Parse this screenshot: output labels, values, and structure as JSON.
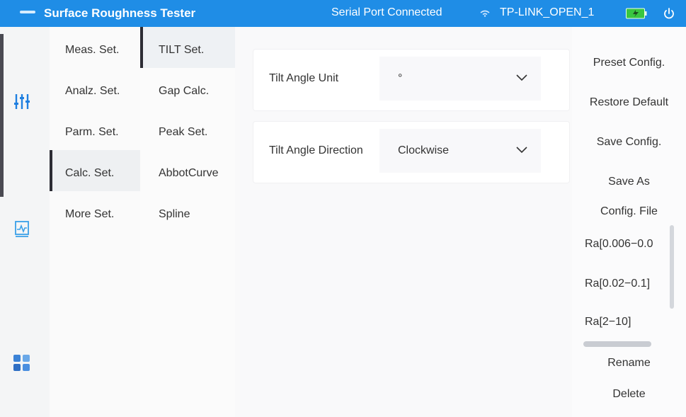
{
  "titlebar": {
    "app_title": "Surface Roughness Tester",
    "port_status": "Serial Port Connected",
    "wifi_name": "TP-LINK_OPEN_1"
  },
  "rail": {
    "icons": [
      "sliders-icon",
      "chart-icon",
      "grid-apps-icon"
    ]
  },
  "menu1": {
    "items": [
      "Meas. Set.",
      "Analz. Set.",
      "Parm. Set.",
      "Calc. Set.",
      "More Set."
    ],
    "active": "Calc. Set."
  },
  "menu2": {
    "items": [
      "TILT Set.",
      "Gap Calc.",
      "Peak Set.",
      "AbbotCurve",
      "Spline"
    ],
    "active": "TILT Set."
  },
  "settings": {
    "tilt_unit": {
      "label": "Tilt Angle Unit",
      "value": "°"
    },
    "tilt_direction": {
      "label": "Tilt Angle Direction",
      "value": "Clockwise"
    }
  },
  "actions": {
    "preset_config": "Preset Config.",
    "restore_default": "Restore Default",
    "save_config": "Save Config.",
    "save_as": "Save As",
    "config_file": "Config. File",
    "files": [
      "Ra[0.006−0.0",
      "Ra[0.02−0.1]",
      "Ra[2−10]"
    ],
    "rename": "Rename",
    "delete": "Delete"
  },
  "colors": {
    "titlebar": "#1f8de6",
    "battery": "#39c640",
    "active_marker": "#2c2c34"
  }
}
